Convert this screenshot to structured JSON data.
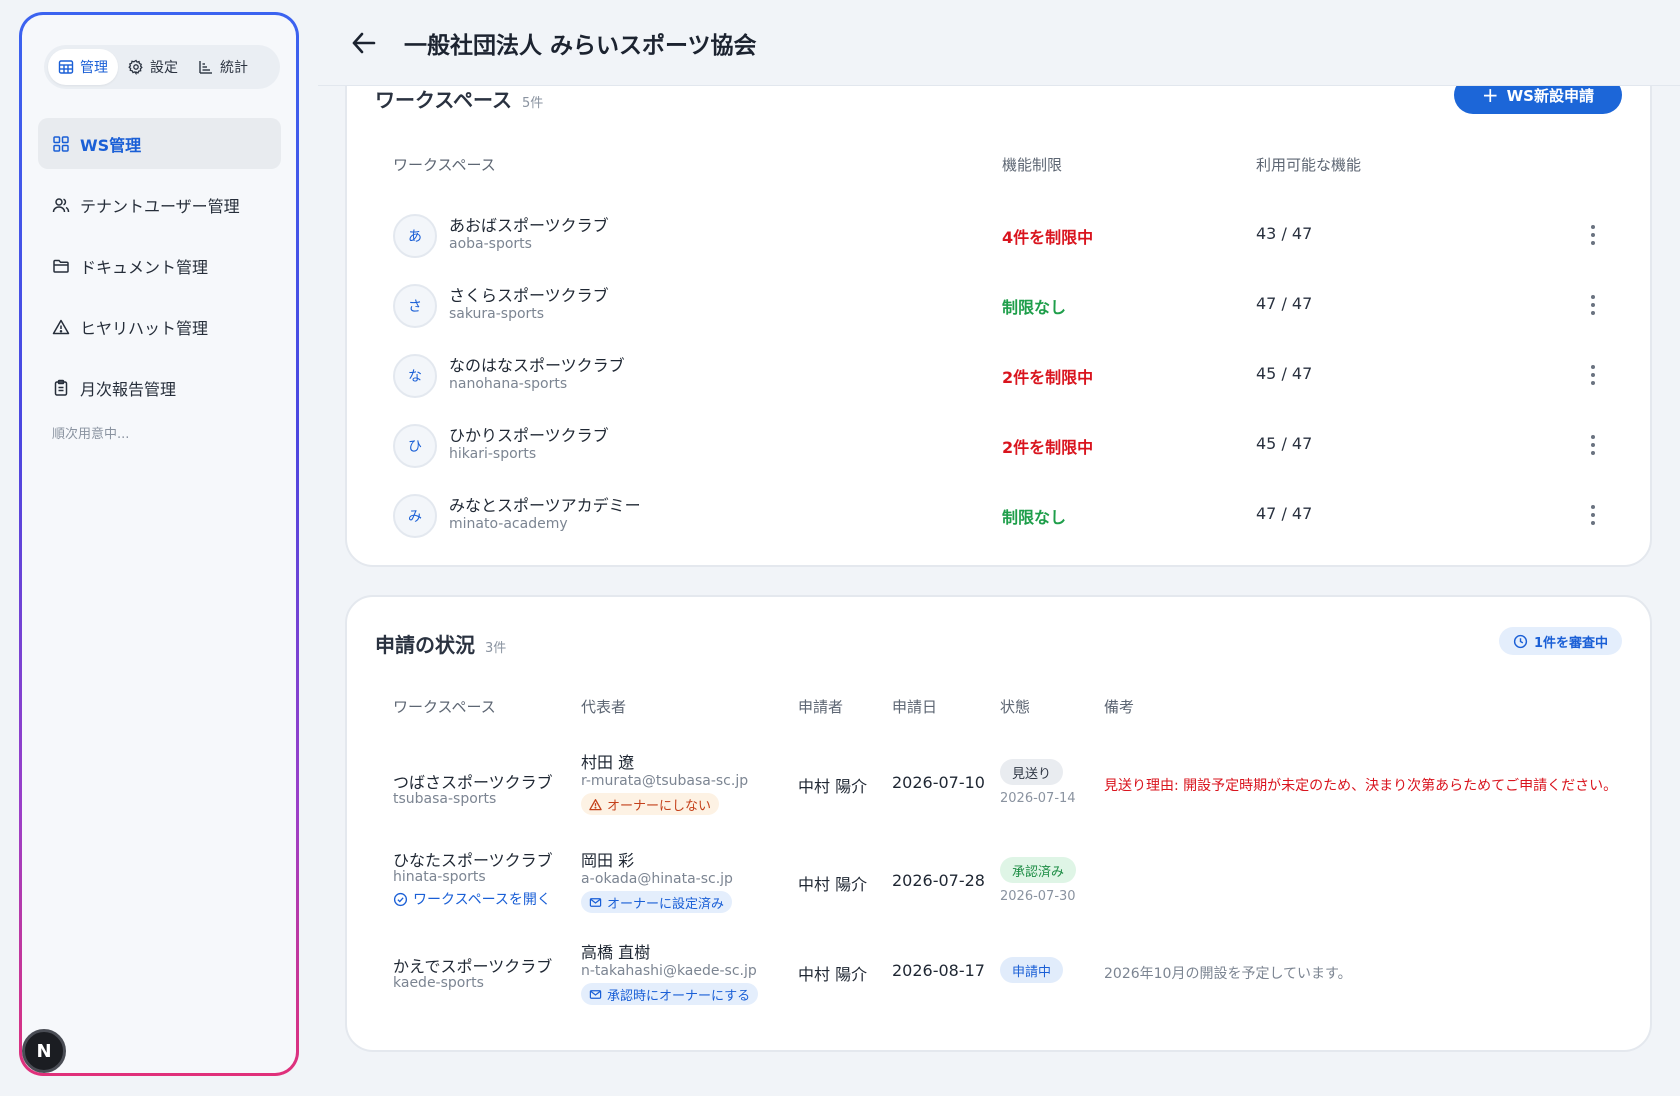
{
  "header": {
    "title": "一般社団法人 みらいスポーツ協会"
  },
  "modes": [
    {
      "label": "管理",
      "icon": "table-icon"
    },
    {
      "label": "設定",
      "icon": "gear-icon"
    },
    {
      "label": "統計",
      "icon": "chart-icon"
    }
  ],
  "sidebar": {
    "items": [
      {
        "label": "WS管理",
        "icon": "grid-icon"
      },
      {
        "label": "テナントユーザー管理",
        "icon": "users-icon"
      },
      {
        "label": "ドキュメント管理",
        "icon": "folder-icon"
      },
      {
        "label": "ヒヤリハット管理",
        "icon": "warning-icon"
      },
      {
        "label": "月次報告管理",
        "icon": "clipboard-icon"
      }
    ],
    "note": "順次用意中..."
  },
  "badge": {
    "letter": "N"
  },
  "workspaces": {
    "title": "ワークスペース",
    "count": "5件",
    "new_button": "WS新設申請",
    "headers": {
      "workspace": "ワークスペース",
      "limit": "機能制限",
      "available": "利用可能な機能"
    },
    "rows": [
      {
        "initial": "あ",
        "name": "あおばスポーツクラブ",
        "slug": "aoba-sports",
        "limit": "4件を制限中",
        "limit_color": "#d9141e",
        "available": "43 / 47"
      },
      {
        "initial": "さ",
        "name": "さくらスポーツクラブ",
        "slug": "sakura-sports",
        "limit": "制限なし",
        "limit_color": "#1e9e4a",
        "available": "47 / 47"
      },
      {
        "initial": "な",
        "name": "なのはなスポーツクラブ",
        "slug": "nanohana-sports",
        "limit": "2件を制限中",
        "limit_color": "#d9141e",
        "available": "45 / 47"
      },
      {
        "initial": "ひ",
        "name": "ひかりスポーツクラブ",
        "slug": "hikari-sports",
        "limit": "2件を制限中",
        "limit_color": "#d9141e",
        "available": "45 / 47"
      },
      {
        "initial": "み",
        "name": "みなとスポーツアカデミー",
        "slug": "minato-academy",
        "limit": "制限なし",
        "limit_color": "#1e9e4a",
        "available": "47 / 47"
      }
    ]
  },
  "applications": {
    "title": "申請の状況",
    "count": "3件",
    "review_badge": "1件を審査中",
    "headers": {
      "workspace": "ワークスペース",
      "representative": "代表者",
      "applicant": "申請者",
      "date": "申請日",
      "status": "状態",
      "note": "備考"
    },
    "rows": [
      {
        "ws": "つばさスポーツクラブ",
        "slug": "tsubasa-sports",
        "rep": "村田 遼",
        "mail": "r-murata@tsubasa-sc.jp",
        "pill": "オーナーにしない",
        "applicant": "中村 陽介",
        "date": "2026-07-10",
        "status": "見送り",
        "status_date": "2026-07-14",
        "note": "見送り理由: 開設予定時期が未定のため、決まり次第あらためてご申請ください。"
      },
      {
        "ws": "ひなたスポーツクラブ",
        "slug": "hinata-sports",
        "link": "ワークスペースを開く",
        "rep": "岡田 彩",
        "mail": "a-okada@hinata-sc.jp",
        "pill": "オーナーに設定済み",
        "applicant": "中村 陽介",
        "date": "2026-07-28",
        "status": "承認済み",
        "status_date": "2026-07-30",
        "note": ""
      },
      {
        "ws": "かえでスポーツクラブ",
        "slug": "kaede-sports",
        "rep": "高橋 直樹",
        "mail": "n-takahashi@kaede-sc.jp",
        "pill": "承認時にオーナーにする",
        "applicant": "中村 陽介",
        "date": "2026-08-17",
        "status": "申請中",
        "status_date": "",
        "note": "2026年10月の開設を予定しています。"
      }
    ]
  }
}
